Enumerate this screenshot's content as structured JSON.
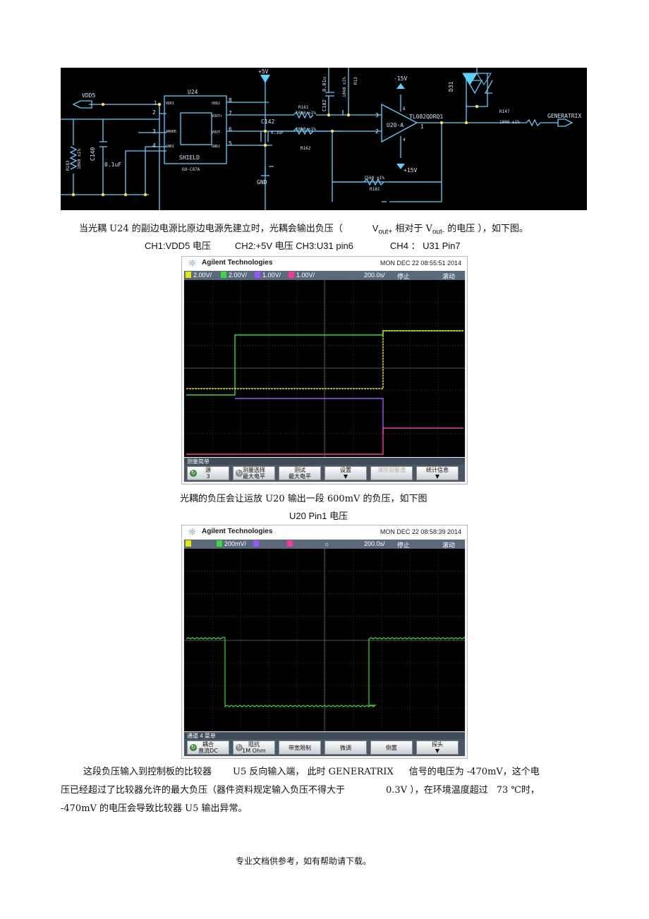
{
  "schematic": {
    "labels": {
      "vdd5": "VDD5",
      "plus5v": "+5V",
      "u24": "U24",
      "r183": "R183",
      "r183_val": "10k0 ±1%",
      "c140": "C140",
      "c140_val": "0.1uF",
      "vdd1": "VDD1",
      "vdd2": "VDD2",
      "vout_p": "VOUT+",
      "vout_m": "VOUT-",
      "gnd2": "GND2",
      "gnd1": "GND1",
      "anode": "ANODE",
      "shield": "SHIELD",
      "part": "GO-C87A",
      "c142": "C142",
      "c142_val": "0.1uF",
      "r161": "R161",
      "r161_val": "10k0 ±1%",
      "r162_val": "10k0 ±1%",
      "r162": "R162",
      "c102": "C102",
      "c102_val": "0.01u",
      "r10k": "10k0 ±1%",
      "r13": "R13",
      "m15v": "-15V",
      "p15v": "+15V",
      "u20": "U20-A",
      "tl082": "TL082QDRQ1",
      "d31": "D31",
      "r147": "R147",
      "r147_val": "1000 ±1%",
      "generatrix": "GENERATRIX",
      "r181_val": "15k0 ±1%",
      "r181": "R181",
      "r15k": "15k0 ±1%",
      "gnd": "GND",
      "pin1": "1",
      "pin2": "2",
      "pin3": "3",
      "pin4": "4",
      "pin5": "5",
      "pin6": "6",
      "pin7": "7",
      "pin8": "8",
      "op3": "3",
      "op2": "2",
      "op1": "1",
      "op8": "8",
      "op4": "4"
    }
  },
  "para1": {
    "text_a": "当光耦  U24 的副边电源比原边电源先建立时，光耦会输出负压（",
    "v1": "V",
    "sub1": "out+",
    "mid": " 相对于  V",
    "sub2": "out-",
    "text_b": " 的电压  ），如下图。"
  },
  "channels_line": {
    "ch1": "CH1:VDD5  电压",
    "ch2": "CH2:+5V  电压 CH3:U31 pin6",
    "ch4": "CH4 ：  U31 Pin7"
  },
  "scope1": {
    "brand": "Agilent Technologies",
    "date": "MON DEC 22 08:55:51 2014",
    "ch1_scale": "2.00V/",
    "ch2_scale": "2.00V/",
    "ch3_scale": "1.00V/",
    "ch4_scale": "1.00V/",
    "timebase": "200.0s/",
    "status": "停止",
    "mode": "滚动",
    "menu_title": "测量简单",
    "softkeys": [
      {
        "line1": "源",
        "line2": "3"
      },
      {
        "line1": "测量选择",
        "line2": "最大电平"
      },
      {
        "line1": "测试",
        "line2": "最大电平"
      },
      {
        "line1": "设置",
        "line2": "▼"
      },
      {
        "line1": "清除测量值",
        "line2": ""
      },
      {
        "line1": "统计信息",
        "line2": "▼"
      }
    ],
    "colors": {
      "ch1": "#e6e600",
      "ch2": "#33dd33",
      "ch3": "#9955ff",
      "ch4": "#ff3399"
    }
  },
  "para2": {
    "line1": "光耦的负压会让运放  U20 输出一段    600mV  的负压，如下图",
    "line2": "U20 Pin1  电压"
  },
  "scope2": {
    "brand": "Agilent Technologies",
    "date": "MON DEC 22 08:58:39 2014",
    "ch_num": "2",
    "ch_scale": "200mV/",
    "timebase": "200.0s/",
    "status": "停止",
    "mode": "滚动",
    "menu_title": "通道 4  菜单",
    "softkeys": [
      {
        "line1": "耦合",
        "line2": "直流DC"
      },
      {
        "line1": "阻抗",
        "line2": "1M Ohm"
      },
      {
        "line1": "带宽限制",
        "line2": ""
      },
      {
        "line1": "微调",
        "line2": ""
      },
      {
        "line1": "倒置",
        "line2": ""
      },
      {
        "line1": "探头",
        "line2": "▼"
      }
    ]
  },
  "para3": {
    "line1_a": "这段负压输入到控制板的比较器",
    "line1_b": "U5 反向输入端，  此时 GENERATRIX",
    "line1_c": "信号的电压为   -470mV，这个电",
    "line2_a": "压已经超过了比较器允许的最大负压（器件资料规定输入负压不得大于",
    "line2_b": "0.3V ），在环境温度超过",
    "line2_c": "73 ℃时，",
    "line3": "-470mV  的电压会导致比较器      U5 输出异常。"
  },
  "footer": "专业文档供参考，如有帮助请下载。"
}
